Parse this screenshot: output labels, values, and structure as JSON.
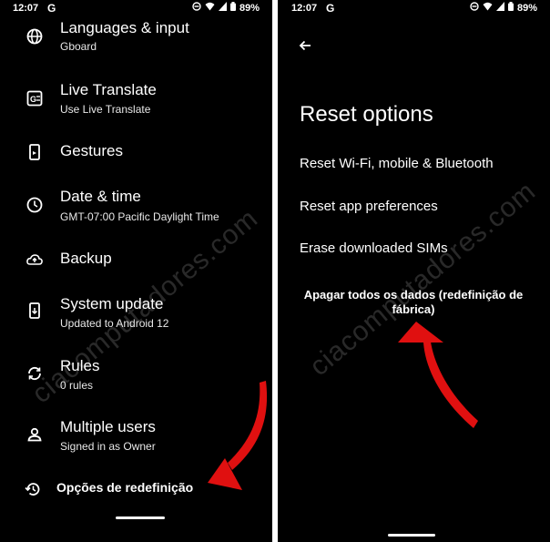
{
  "status_bar": {
    "time": "12:07",
    "g_glyph": "G",
    "battery": "89%"
  },
  "left_screen": {
    "items": [
      {
        "icon": "globe-icon",
        "title": "Languages & input",
        "subtitle": "Gboard"
      },
      {
        "icon": "translate-icon",
        "title": "Live Translate",
        "subtitle": "Use Live Translate"
      },
      {
        "icon": "phone-gesture-icon",
        "title": "Gestures",
        "subtitle": ""
      },
      {
        "icon": "clock-icon",
        "title": "Date & time",
        "subtitle": "GMT-07:00 Pacific Daylight Time"
      },
      {
        "icon": "cloud-upload-icon",
        "title": "Backup",
        "subtitle": ""
      },
      {
        "icon": "system-update-icon",
        "title": "System update",
        "subtitle": "Updated to Android 12"
      },
      {
        "icon": "rules-icon",
        "title": "Rules",
        "subtitle": "0 rules"
      },
      {
        "icon": "person-icon",
        "title": "Multiple users",
        "subtitle": "Signed in as Owner"
      },
      {
        "icon": "history-icon",
        "title": "Opções de redefinição",
        "subtitle": ""
      }
    ]
  },
  "right_screen": {
    "title": "Reset options",
    "options": [
      "Reset Wi-Fi, mobile & Bluetooth",
      "Reset app preferences",
      "Erase downloaded SIMs"
    ],
    "factory_reset": "Apagar todos os dados (redefinição de fábrica)"
  },
  "watermark": "ciacomputadores.com",
  "colors": {
    "arrow": "#e01010",
    "background": "#000000",
    "text": "#ffffff"
  }
}
